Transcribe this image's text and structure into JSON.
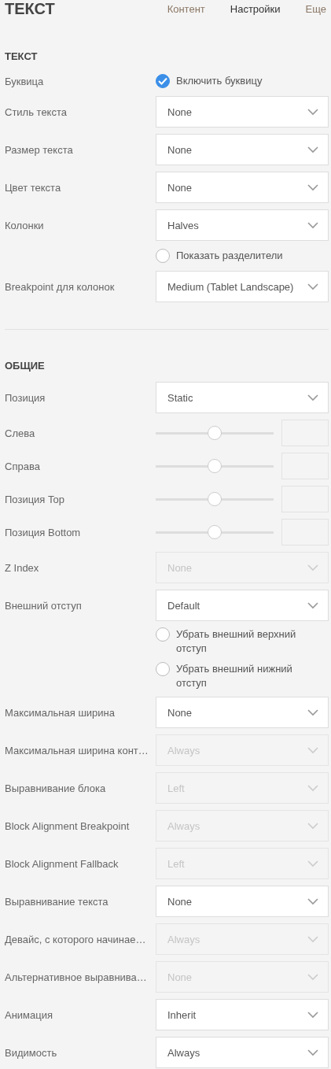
{
  "header": {
    "title": "ТЕКСТ",
    "tabs": [
      {
        "label": "Контент",
        "selected": false
      },
      {
        "label": "Настройки",
        "selected": true
      },
      {
        "label": "Еще",
        "selected": false
      }
    ]
  },
  "sections": [
    {
      "title": "ТЕКСТ",
      "rows": [
        {
          "kind": "checkbox",
          "label": "Буквица",
          "text": "Включить буквицу",
          "checked": true
        },
        {
          "kind": "select",
          "label": "Стиль текста",
          "value": "None",
          "disabled": false
        },
        {
          "kind": "select",
          "label": "Размер текста",
          "value": "None",
          "disabled": false
        },
        {
          "kind": "select",
          "label": "Цвет текста",
          "value": "None",
          "disabled": false
        },
        {
          "kind": "select",
          "label": "Колонки",
          "value": "Halves",
          "disabled": false
        },
        {
          "kind": "checkbox",
          "text": "Показать разделители",
          "checked": false
        },
        {
          "kind": "select",
          "label": "Breakpoint для колонок",
          "value": "Medium (Tablet Landscape)",
          "disabled": false
        }
      ]
    },
    {
      "title": "ОБЩИЕ",
      "rows": [
        {
          "kind": "select",
          "label": "Позиция",
          "value": "Static",
          "disabled": false
        },
        {
          "kind": "slider",
          "label": "Слева",
          "level": 0.5
        },
        {
          "kind": "slider",
          "label": "Справа",
          "level": 0.5
        },
        {
          "kind": "slider",
          "label": "Позиция Top",
          "level": 0.5
        },
        {
          "kind": "slider",
          "label": "Позиция Bottom",
          "level": 0.5
        },
        {
          "kind": "select",
          "label": "Z Index",
          "value": "None",
          "disabled": true
        },
        {
          "kind": "select",
          "label": "Внешний отступ",
          "value": "Default",
          "disabled": false
        },
        {
          "kind": "checkbox",
          "text": "Убрать внешний верхний отступ",
          "checked": false
        },
        {
          "kind": "checkbox",
          "text": "Убрать внешний нижний отступ",
          "checked": false
        },
        {
          "kind": "select",
          "label": "Максимальная ширина",
          "value": "None",
          "disabled": false
        },
        {
          "kind": "select",
          "label": "Максимальная ширина конт…",
          "value": "Always",
          "disabled": true
        },
        {
          "kind": "select",
          "label": "Выравнивание блока",
          "value": "Left",
          "disabled": true
        },
        {
          "kind": "select",
          "label": "Block Alignment Breakpoint",
          "value": "Always",
          "disabled": true
        },
        {
          "kind": "select",
          "label": "Block Alignment Fallback",
          "value": "Left",
          "disabled": true
        },
        {
          "kind": "select",
          "label": "Выравнивание текста",
          "value": "None",
          "disabled": false
        },
        {
          "kind": "select",
          "label": "Девайс, с которого начинае…",
          "value": "Always",
          "disabled": true
        },
        {
          "kind": "select",
          "label": "Альтернативное выравнива…",
          "value": "None",
          "disabled": true
        },
        {
          "kind": "select",
          "label": "Анимация",
          "value": "Inherit",
          "disabled": false
        },
        {
          "kind": "select",
          "label": "Видимость",
          "value": "Always",
          "disabled": false
        }
      ]
    }
  ]
}
